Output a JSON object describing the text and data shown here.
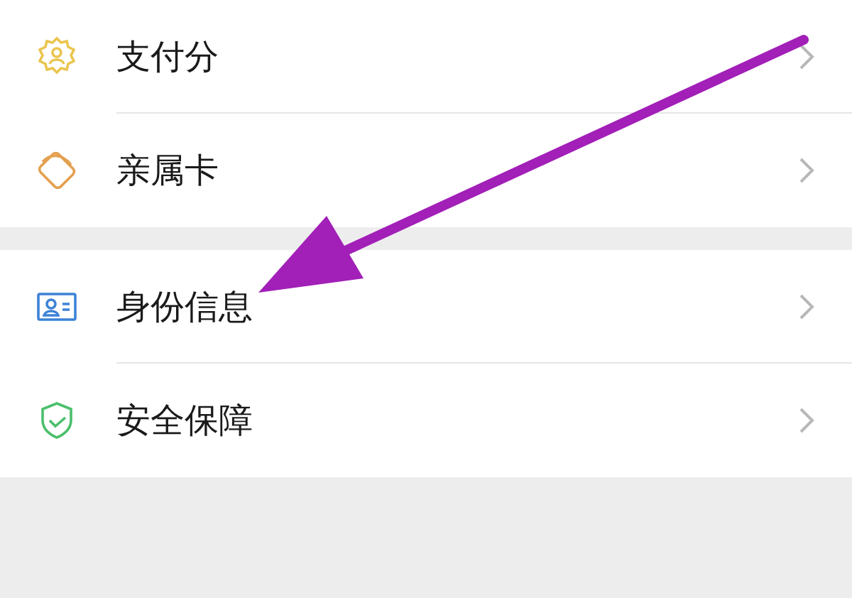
{
  "groups": [
    {
      "items": [
        {
          "kind": "score",
          "label": "支付分"
        },
        {
          "kind": "card",
          "label": "亲属卡"
        }
      ]
    },
    {
      "items": [
        {
          "kind": "id",
          "label": "身份信息"
        },
        {
          "kind": "shield",
          "label": "安全保障"
        }
      ]
    }
  ]
}
